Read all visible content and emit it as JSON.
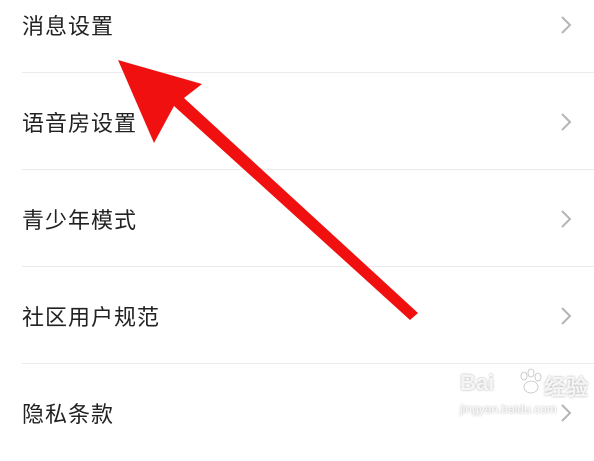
{
  "settings": {
    "items": [
      {
        "label": "消息设置"
      },
      {
        "label": "语音房设置"
      },
      {
        "label": "青少年模式"
      },
      {
        "label": "社区用户规范"
      },
      {
        "label": "隐私条款"
      }
    ]
  },
  "watermark": {
    "brand_left": "Bai",
    "brand_right": "经验",
    "url": "jingyan.baidu.com"
  },
  "colors": {
    "arrow": "#f01010",
    "chevron": "#b5b5b5",
    "text": "#222222",
    "divider": "#ebebeb"
  },
  "icons": {
    "chevron": "chevron-right-icon",
    "arrow": "red-arrow-annotation",
    "watermark_logo": "baidu-paw-icon"
  }
}
